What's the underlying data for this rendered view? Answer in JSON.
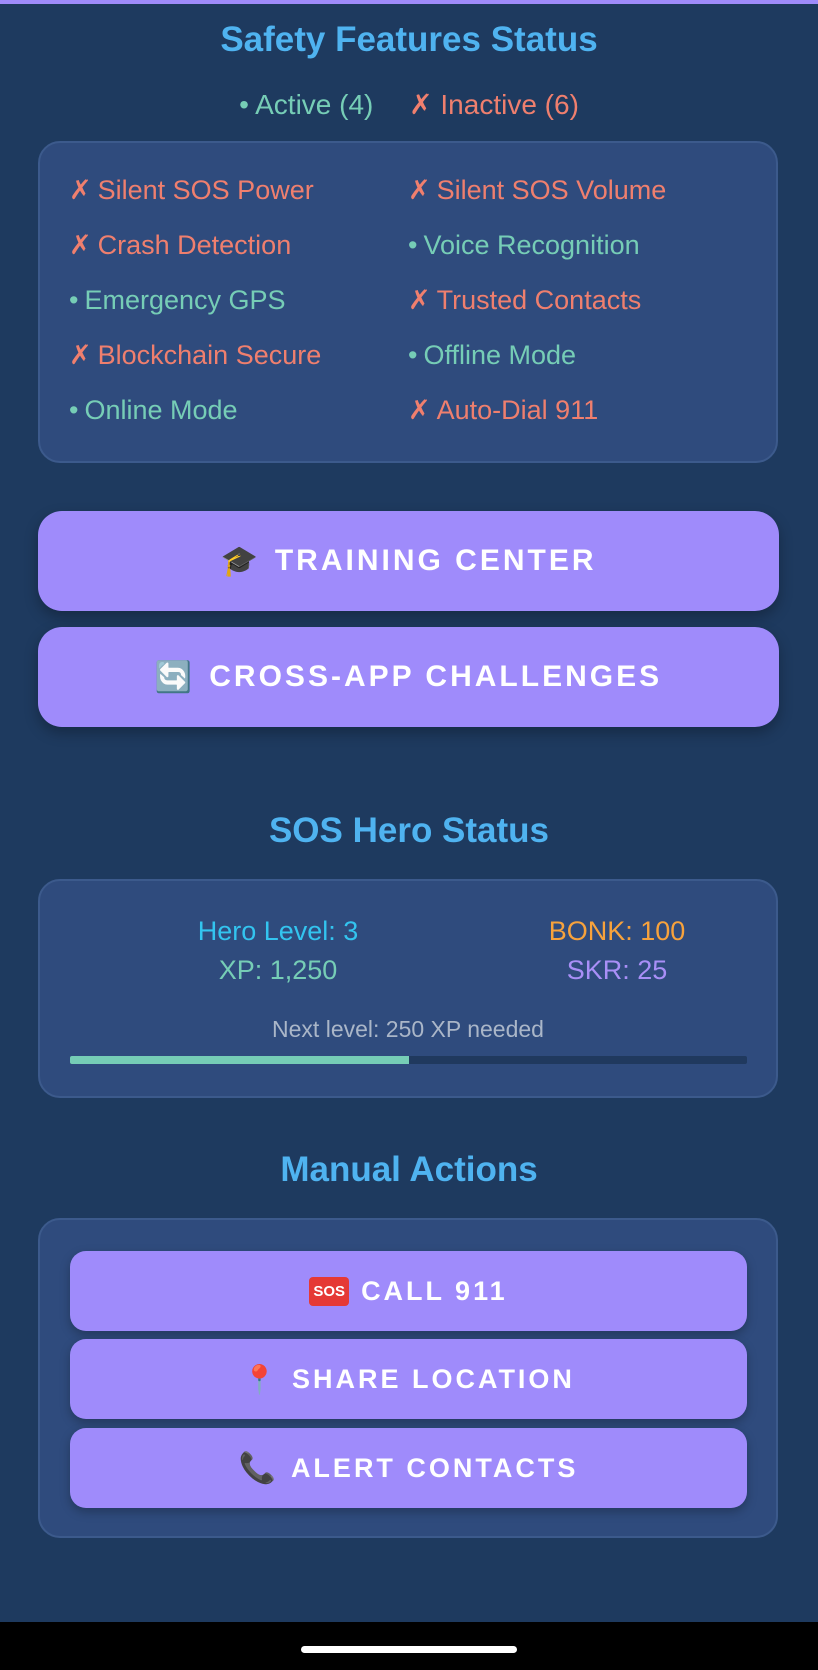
{
  "colors": {
    "background": "#1e3a5f",
    "card": "#2f4b7d",
    "accent_purple": "#9f8bfb",
    "title_blue": "#4fb3f0",
    "active_green": "#76cdb6",
    "inactive_red": "#ef7f6e",
    "hero_level_cyan": "#33c4ef",
    "bonk_orange": "#f7a23c",
    "skr_purple": "#a98ff7"
  },
  "safety": {
    "title": "Safety Features Status",
    "active_summary": "• Active (4)",
    "inactive_summary": "✗ Inactive (6)",
    "features": [
      {
        "mark": "✗",
        "label": "Silent SOS Power",
        "active": false
      },
      {
        "mark": "✗",
        "label": "Silent SOS Volume",
        "active": false
      },
      {
        "mark": "✗",
        "label": "Crash Detection",
        "active": false
      },
      {
        "mark": "•",
        "label": "Voice Recognition",
        "active": true
      },
      {
        "mark": "•",
        "label": "Emergency GPS",
        "active": true
      },
      {
        "mark": "✗",
        "label": "Trusted Contacts",
        "active": false
      },
      {
        "mark": "✗",
        "label": "Blockchain Secure",
        "active": false
      },
      {
        "mark": "•",
        "label": "Offline Mode",
        "active": true
      },
      {
        "mark": "•",
        "label": "Online Mode",
        "active": true
      },
      {
        "mark": "✗",
        "label": "Auto-Dial 911",
        "active": false
      }
    ]
  },
  "buttons": {
    "training_icon": "graduation-cap-icon",
    "training_label": "TRAINING CENTER",
    "cross_app_icon": "refresh-icon",
    "cross_app_label": "CROSS-APP CHALLENGES"
  },
  "hero": {
    "title": "SOS Hero Status",
    "level": "Hero Level: 3",
    "xp": "XP: 1,250",
    "bonk": "BONK: 100",
    "skr": "SKR: 25",
    "next_level": "Next level: 250 XP needed",
    "progress_percent": 50
  },
  "manual": {
    "title": "Manual Actions",
    "call_icon": "sos-icon",
    "call_label": "CALL 911",
    "share_icon": "location-pin-icon",
    "share_label": "SHARE LOCATION",
    "alert_icon": "phone-icon",
    "alert_label": "ALERT CONTACTS"
  }
}
